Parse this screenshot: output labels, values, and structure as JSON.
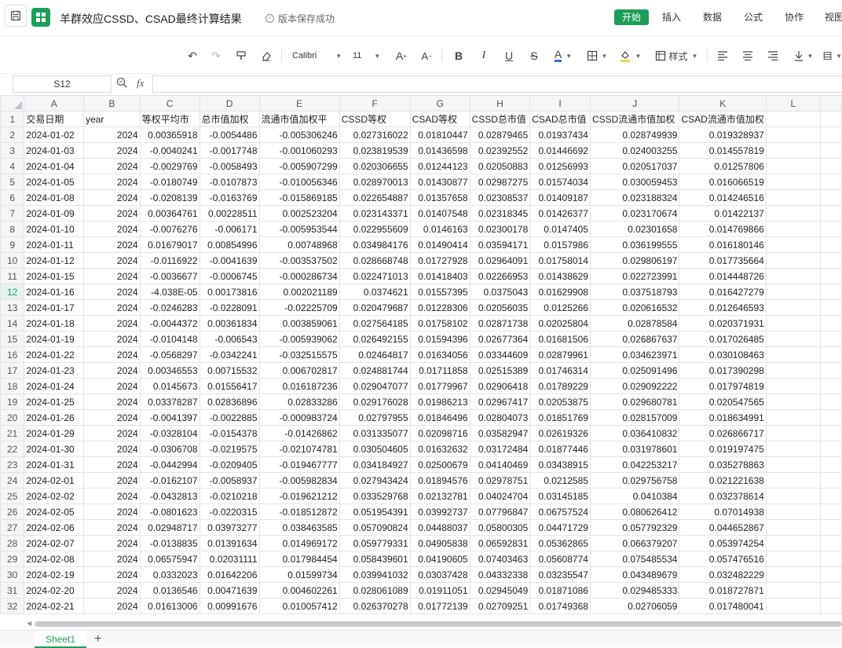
{
  "header": {
    "title": "羊群效应CSSD、CSAD最终计算结果",
    "save_status": "版本保存成功",
    "menus": [
      "开始",
      "插入",
      "数据",
      "公式",
      "协作",
      "视图"
    ]
  },
  "toolbar": {
    "font_name": "Calibri",
    "font_size": "11",
    "style_label": "样式"
  },
  "formula_bar": {
    "cell_ref": "S12",
    "fx_label": "fx",
    "formula": ""
  },
  "columns": [
    "A",
    "B",
    "C",
    "D",
    "E",
    "F",
    "G",
    "H",
    "I",
    "J",
    "K",
    "L"
  ],
  "header_row": [
    "交易日期",
    "year",
    "等权平均市",
    "总市值加权",
    "流通市值加权平",
    "CSSD等权",
    "CSAD等权",
    "CSSD总市值",
    "CSAD总市值",
    "CSSD流通市值加权",
    "CSAD流通市值加权",
    ""
  ],
  "rows": [
    [
      "2024-01-02",
      "2024",
      "0.00365918",
      "-0.0054486",
      "-0.005306246",
      "0.027316022",
      "0.01810447",
      "0.02879465",
      "0.01937434",
      "0.028749939",
      "0.019328937",
      ""
    ],
    [
      "2024-01-03",
      "2024",
      "-0.0040241",
      "-0.0017748",
      "-0.001060293",
      "0.023819539",
      "0.01436598",
      "0.02392552",
      "0.01446692",
      "0.024003255",
      "0.014557819",
      ""
    ],
    [
      "2024-01-04",
      "2024",
      "-0.0029769",
      "-0.0058493",
      "-0.005907299",
      "0.020306655",
      "0.01244123",
      "0.02050883",
      "0.01256993",
      "0.020517037",
      "0.01257806",
      ""
    ],
    [
      "2024-01-05",
      "2024",
      "-0.0180749",
      "-0.0107873",
      "-0.010056346",
      "0.028970013",
      "0.01430877",
      "0.02987275",
      "0.01574034",
      "0.030059453",
      "0.016066519",
      ""
    ],
    [
      "2024-01-08",
      "2024",
      "-0.0208139",
      "-0.0163769",
      "-0.015869185",
      "0.022654887",
      "0.01357658",
      "0.02308537",
      "0.01409187",
      "0.023188324",
      "0.014246516",
      ""
    ],
    [
      "2024-01-09",
      "2024",
      "0.00364761",
      "0.00228511",
      "0.002523204",
      "0.023143371",
      "0.01407548",
      "0.02318345",
      "0.01426377",
      "0.023170674",
      "0.01422137",
      ""
    ],
    [
      "2024-01-10",
      "2024",
      "-0.0076276",
      "-0.006171",
      "-0.005953544",
      "0.022955609",
      "0.0146163",
      "0.02300178",
      "0.0147405",
      "0.02301658",
      "0.014769866",
      ""
    ],
    [
      "2024-01-11",
      "2024",
      "0.01679017",
      "0.00854996",
      "0.00748968",
      "0.034984176",
      "0.01490414",
      "0.03594171",
      "0.0157986",
      "0.036199555",
      "0.016180146",
      ""
    ],
    [
      "2024-01-12",
      "2024",
      "-0.0116922",
      "-0.0041639",
      "-0.003537502",
      "0.028668748",
      "0.01727928",
      "0.02964091",
      "0.01758014",
      "0.029806197",
      "0.017735664",
      ""
    ],
    [
      "2024-01-15",
      "2024",
      "-0.0036677",
      "-0.0006745",
      "-0.000286734",
      "0.022471013",
      "0.01418403",
      "0.02266953",
      "0.01438629",
      "0.022723991",
      "0.014448726",
      ""
    ],
    [
      "2024-01-16",
      "2024",
      "-4.038E-05",
      "0.00173816",
      "0.002021189",
      "0.0374621",
      "0.01557395",
      "0.0375043",
      "0.01629908",
      "0.037518793",
      "0.016427279",
      ""
    ],
    [
      "2024-01-17",
      "2024",
      "-0.0246283",
      "-0.0228091",
      "-0.02225709",
      "0.020479687",
      "0.01228306",
      "0.02056035",
      "0.0125266",
      "0.020616532",
      "0.012646593",
      ""
    ],
    [
      "2024-01-18",
      "2024",
      "-0.0044372",
      "0.00361834",
      "0.003859061",
      "0.027564185",
      "0.01758102",
      "0.02871738",
      "0.02025804",
      "0.02878584",
      "0.020371931",
      ""
    ],
    [
      "2024-01-19",
      "2024",
      "-0.0104148",
      "-0.006543",
      "-0.005939062",
      "0.026492155",
      "0.01594396",
      "0.02677364",
      "0.01681506",
      "0.026867637",
      "0.017026485",
      ""
    ],
    [
      "2024-01-22",
      "2024",
      "-0.0568297",
      "-0.0342241",
      "-0.032515575",
      "0.02464817",
      "0.01634056",
      "0.03344609",
      "0.02879961",
      "0.034623971",
      "0.030108463",
      ""
    ],
    [
      "2024-01-23",
      "2024",
      "0.00346553",
      "0.00715532",
      "0.006702817",
      "0.024881744",
      "0.01711858",
      "0.02515389",
      "0.01746314",
      "0.025091496",
      "0.017390298",
      ""
    ],
    [
      "2024-01-24",
      "2024",
      "0.0145673",
      "0.01556417",
      "0.016187236",
      "0.029047077",
      "0.01779967",
      "0.02906418",
      "0.01789229",
      "0.029092222",
      "0.017974819",
      ""
    ],
    [
      "2024-01-25",
      "2024",
      "0.03378287",
      "0.02836896",
      "0.02833286",
      "0.029176028",
      "0.01986213",
      "0.02967417",
      "0.02053875",
      "0.029680781",
      "0.020547565",
      ""
    ],
    [
      "2024-01-26",
      "2024",
      "-0.0041397",
      "-0.0022885",
      "-0.000983724",
      "0.02797955",
      "0.01846496",
      "0.02804073",
      "0.01851769",
      "0.028157009",
      "0.018634991",
      ""
    ],
    [
      "2024-01-29",
      "2024",
      "-0.0328104",
      "-0.0154378",
      "-0.01426862",
      "0.031335077",
      "0.02098716",
      "0.03582947",
      "0.02619326",
      "0.036410832",
      "0.026866717",
      ""
    ],
    [
      "2024-01-30",
      "2024",
      "-0.0306708",
      "-0.0219575",
      "-0.021074781",
      "0.030504605",
      "0.01632632",
      "0.03172484",
      "0.01877446",
      "0.031978601",
      "0.019197475",
      ""
    ],
    [
      "2024-01-31",
      "2024",
      "-0.0442994",
      "-0.0209405",
      "-0.019467777",
      "0.034184927",
      "0.02500679",
      "0.04140469",
      "0.03438915",
      "0.042253217",
      "0.035278863",
      ""
    ],
    [
      "2024-02-01",
      "2024",
      "-0.0162107",
      "-0.0058937",
      "-0.005982834",
      "0.027943424",
      "0.01894576",
      "0.02978751",
      "0.0212585",
      "0.029756758",
      "0.021221638",
      ""
    ],
    [
      "2024-02-02",
      "2024",
      "-0.0432813",
      "-0.0210218",
      "-0.019621212",
      "0.033529768",
      "0.02132781",
      "0.04024704",
      "0.03145185",
      "0.0410384",
      "0.032378614",
      ""
    ],
    [
      "2024-02-05",
      "2024",
      "-0.0801623",
      "-0.0220315",
      "-0.018512872",
      "0.051954391",
      "0.03992737",
      "0.07796847",
      "0.06757524",
      "0.080626412",
      "0.07014938",
      ""
    ],
    [
      "2024-02-06",
      "2024",
      "0.02948717",
      "0.03973277",
      "0.038463585",
      "0.057090824",
      "0.04488037",
      "0.05800305",
      "0.04471729",
      "0.057792329",
      "0.044652867",
      ""
    ],
    [
      "2024-02-07",
      "2024",
      "-0.0138835",
      "0.01391634",
      "0.014969172",
      "0.059779331",
      "0.04905838",
      "0.06592831",
      "0.05362865",
      "0.066379207",
      "0.053974254",
      ""
    ],
    [
      "2024-02-08",
      "2024",
      "0.06575947",
      "0.02031111",
      "0.017984454",
      "0.058439601",
      "0.04190605",
      "0.07403463",
      "0.05608774",
      "0.075485534",
      "0.057476516",
      ""
    ],
    [
      "2024-02-19",
      "2024",
      "0.0332023",
      "0.01642206",
      "0.01599734",
      "0.039941032",
      "0.03037428",
      "0.04332338",
      "0.03235547",
      "0.043489679",
      "0.032482229",
      ""
    ],
    [
      "2024-02-20",
      "2024",
      "0.0136546",
      "0.00471639",
      "0.004602261",
      "0.028061089",
      "0.01911051",
      "0.02945049",
      "0.01871086",
      "0.029485333",
      "0.018727871",
      ""
    ],
    [
      "2024-02-21",
      "2024",
      "0.01613006",
      "0.00991676",
      "0.010057412",
      "0.026370278",
      "0.01772139",
      "0.02709251",
      "0.01749368",
      "0.02706059",
      "0.017480041",
      ""
    ]
  ],
  "selected_row": "12",
  "sheets": [
    "Sheet1"
  ]
}
